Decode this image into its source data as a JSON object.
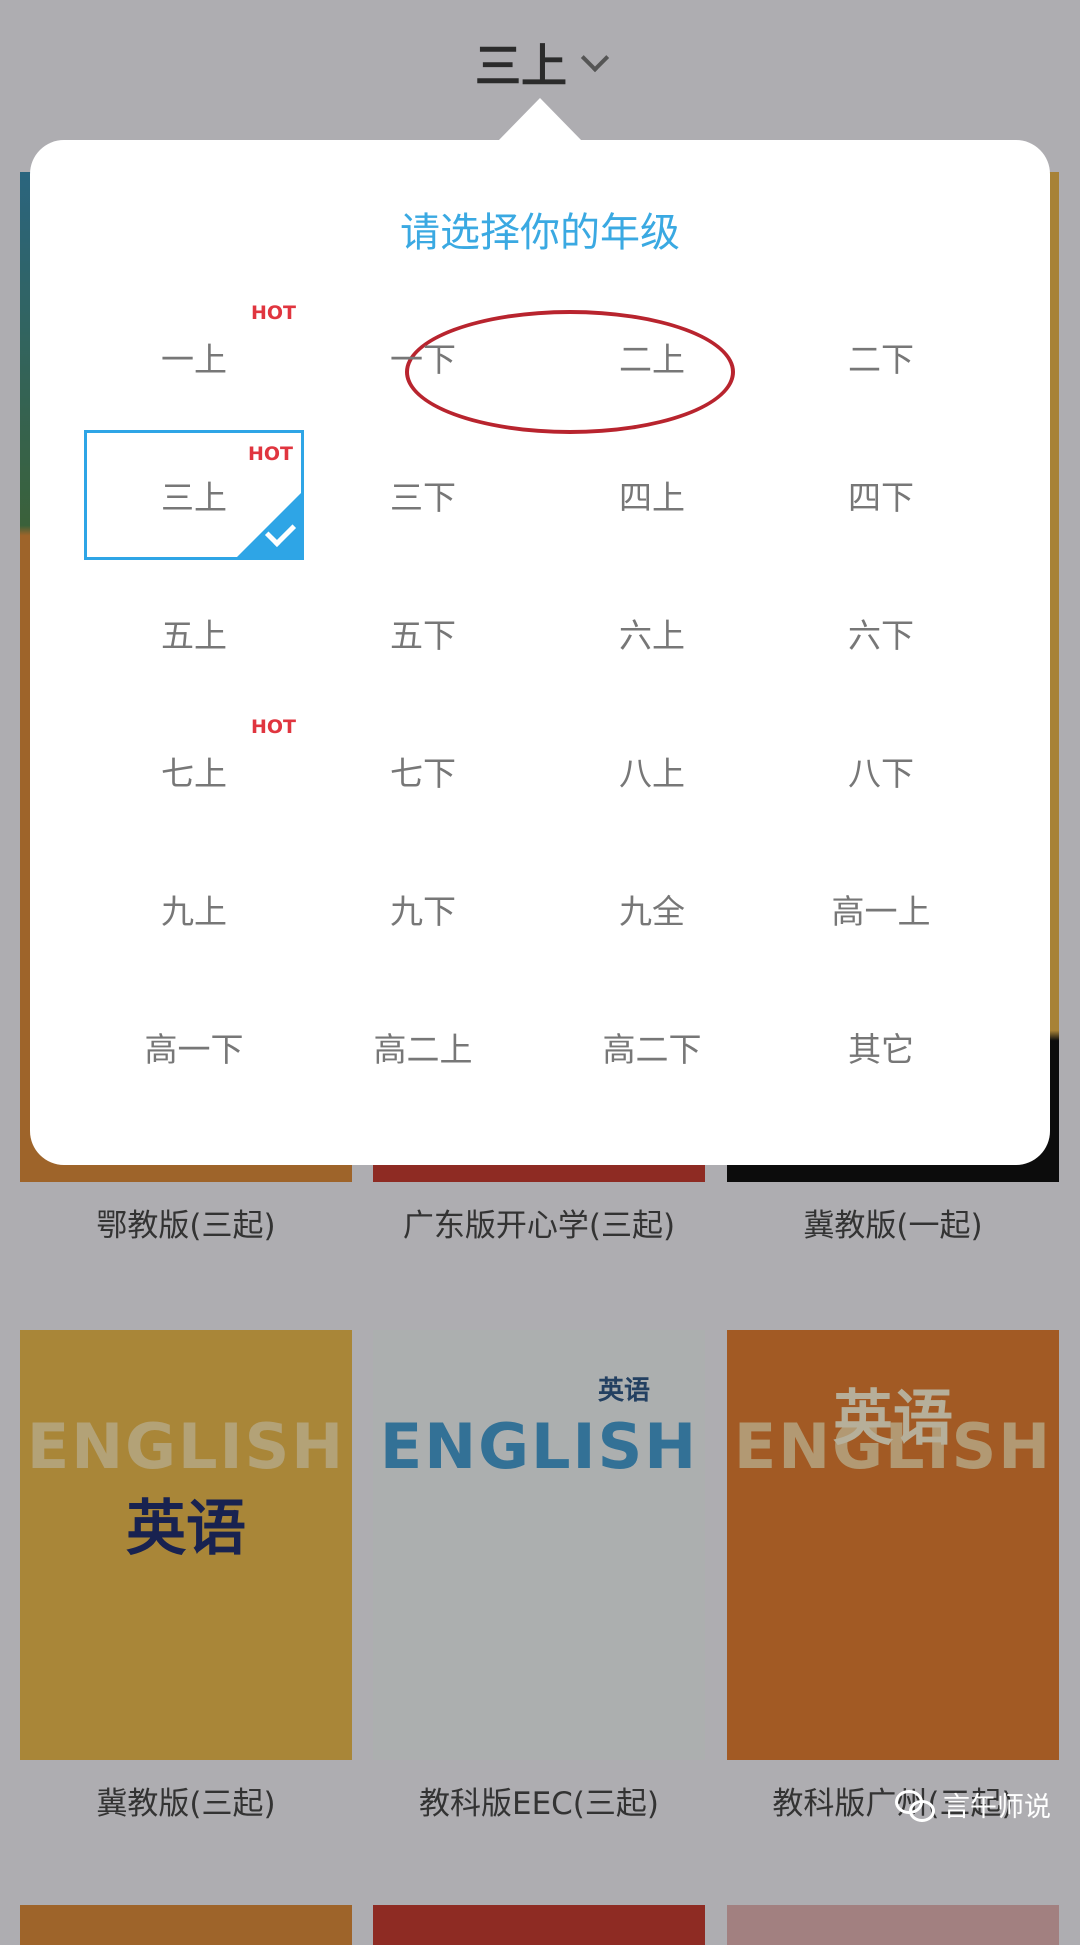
{
  "header": {
    "selected_grade": "三上",
    "chevron_icon": "chevron-down-icon"
  },
  "popup": {
    "title": "请选择你的年级",
    "hot_label": "HOT",
    "selected": "三上",
    "accent_color": "#2ea5e6",
    "annotation_color": "#b8242e",
    "grades": [
      {
        "label": "一上",
        "hot": true
      },
      {
        "label": "一下",
        "hot": false
      },
      {
        "label": "二上",
        "hot": false
      },
      {
        "label": "二下",
        "hot": false
      },
      {
        "label": "三上",
        "hot": true,
        "selected": true
      },
      {
        "label": "三下",
        "hot": false
      },
      {
        "label": "四上",
        "hot": false
      },
      {
        "label": "四下",
        "hot": false
      },
      {
        "label": "五上",
        "hot": false
      },
      {
        "label": "五下",
        "hot": false
      },
      {
        "label": "六上",
        "hot": false
      },
      {
        "label": "六下",
        "hot": false
      },
      {
        "label": "七上",
        "hot": true
      },
      {
        "label": "七下",
        "hot": false
      },
      {
        "label": "八上",
        "hot": false
      },
      {
        "label": "八下",
        "hot": false
      },
      {
        "label": "九上",
        "hot": false
      },
      {
        "label": "九下",
        "hot": false
      },
      {
        "label": "九全",
        "hot": false
      },
      {
        "label": "高一上",
        "hot": false
      },
      {
        "label": "高一下",
        "hot": false
      },
      {
        "label": "高二上",
        "hot": false
      },
      {
        "label": "高二下",
        "hot": false
      },
      {
        "label": "其它",
        "hot": false
      }
    ]
  },
  "books": [
    {
      "label": "鄂教版(三起)",
      "color": "#e8892a",
      "cover_title": "",
      "cover_eng": ""
    },
    {
      "label": "广东版开心学(三起)",
      "color": "#d8362a",
      "cover_title": "",
      "cover_eng": ""
    },
    {
      "label": "冀教版(一起)",
      "color": "#f0b43a",
      "cover_title": "",
      "cover_eng": ""
    },
    {
      "label": "冀教版(三起)",
      "color": "#f3b93a",
      "cover_title": "英语",
      "cover_eng": "ENGLISH"
    },
    {
      "label": "教科版EEC(三起)",
      "color": "#eef3f4",
      "cover_title": "英语",
      "cover_eng": "ENGLISH"
    },
    {
      "label": "教科版广州(三起)",
      "color": "#f07a22",
      "cover_title": "英语",
      "cover_eng": "ENGLISH"
    }
  ],
  "watermark": {
    "text": "言午师说",
    "icon": "wechat-icon"
  }
}
